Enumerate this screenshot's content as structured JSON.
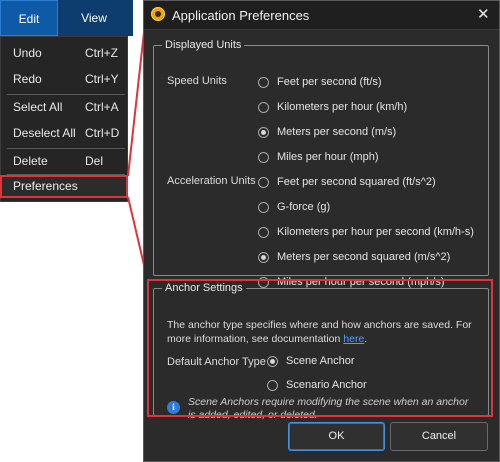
{
  "menubar": {
    "edit": "Edit",
    "view": "View"
  },
  "edit_menu": {
    "items": [
      {
        "label": "Undo",
        "shortcut": "Ctrl+Z"
      },
      {
        "label": "Redo",
        "shortcut": "Ctrl+Y"
      },
      {
        "label": "Select All",
        "shortcut": "Ctrl+A"
      },
      {
        "label": "Deselect All",
        "shortcut": "Ctrl+D"
      },
      {
        "label": "Delete",
        "shortcut": "Del"
      }
    ],
    "preferences": "Preferences"
  },
  "dialog": {
    "title": "Application Preferences",
    "close": "✕",
    "displayed_units": {
      "legend": "Displayed Units",
      "speed_label": "Speed Units",
      "speed_options": [
        {
          "label": "Feet per second (ft/s)",
          "selected": false
        },
        {
          "label": "Kilometers per hour (km/h)",
          "selected": false
        },
        {
          "label": "Meters per second (m/s)",
          "selected": true
        },
        {
          "label": "Miles per hour (mph)",
          "selected": false
        }
      ],
      "accel_label": "Acceleration Units",
      "accel_options": [
        {
          "label": "Feet per second squared (ft/s^2)",
          "selected": false
        },
        {
          "label": "G-force (g)",
          "selected": false
        },
        {
          "label": "Kilometers per hour per second (km/h-s)",
          "selected": false
        },
        {
          "label": "Meters per second squared (m/s^2)",
          "selected": true
        },
        {
          "label": "Miles per hour per second (mph/s)",
          "selected": false
        }
      ]
    },
    "anchor_settings": {
      "legend": "Anchor Settings",
      "description": "The anchor type specifies where and how anchors are saved. For more information, see documentation",
      "link": "here",
      "link_suffix": ".",
      "default_label": "Default Anchor Type",
      "options": [
        {
          "label": "Scene Anchor",
          "selected": true
        },
        {
          "label": "Scenario Anchor",
          "selected": false
        }
      ],
      "info_icon": "i",
      "note": "Scene Anchors require modifying the scene when an anchor is added, edited, or deleted."
    },
    "ok": "OK",
    "cancel": "Cancel"
  },
  "colors": {
    "accent_red": "#e0343a",
    "link_blue": "#4aa0ff",
    "menu_blue": "#0d3d6e"
  }
}
